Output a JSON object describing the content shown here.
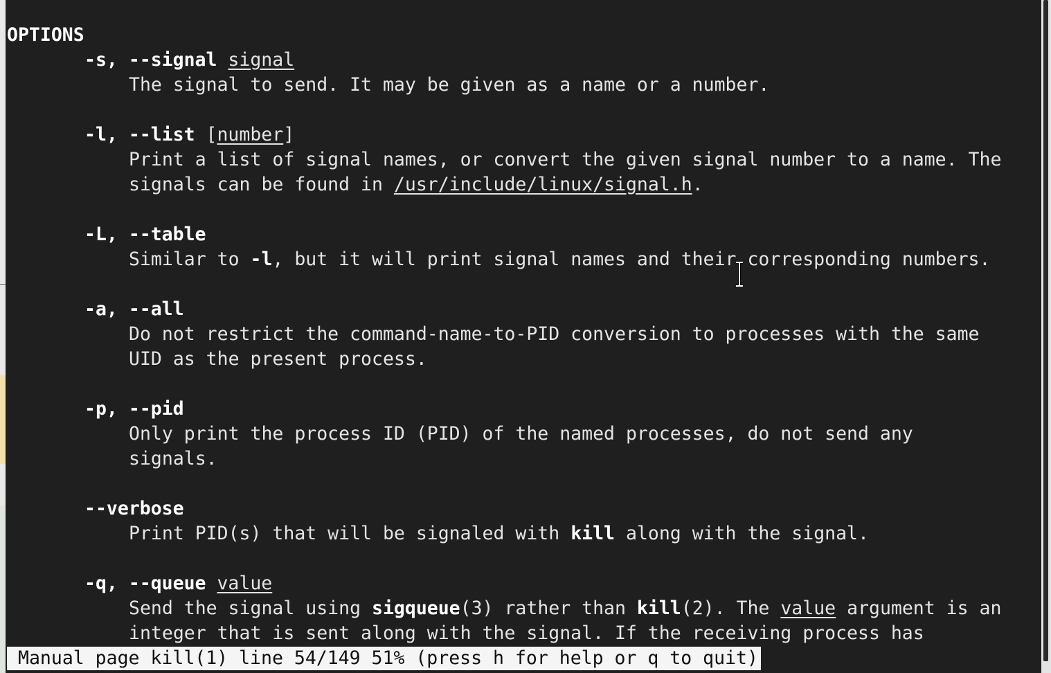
{
  "section_heading": "OPTIONS",
  "options": {
    "signal": {
      "flag": "-s, --signal",
      "arg": "signal",
      "desc": "The signal to send. It may be given as a name or a number."
    },
    "list": {
      "flag": "-l, --list",
      "arg_open": " [",
      "arg": "number",
      "arg_close": "]",
      "desc1": "Print a list of signal names, or convert the given signal number to a name. The",
      "desc2_pre": "signals can be found in ",
      "desc2_link": "/usr/include/linux/signal.h",
      "desc2_post": "."
    },
    "table": {
      "flag": "-L, --table",
      "desc_pre": "Similar to ",
      "desc_bold": "-l",
      "desc_post": ", but it will print signal names and their corresponding numbers."
    },
    "all": {
      "flag": "-a, --all",
      "desc1": "Do not restrict the command-name-to-PID conversion to processes with the same",
      "desc2": "UID as the present process."
    },
    "pid": {
      "flag": "-p, --pid",
      "desc1": "Only print the process ID (PID) of the named processes, do not send any",
      "desc2": "signals."
    },
    "verbose": {
      "flag": "--verbose",
      "desc_pre": "Print PID(s) that will be signaled with ",
      "desc_bold": "kill",
      "desc_post": " along with the signal."
    },
    "queue": {
      "flag": "-q, --queue",
      "arg": "value",
      "desc1_a": "Send the signal using ",
      "desc1_b": "sigqueue",
      "desc1_c": "(3) rather than ",
      "desc1_d": "kill",
      "desc1_e": "(2). The ",
      "desc1_f": "value",
      "desc1_g": " argument is an",
      "desc2": "integer that is sent along with the signal. If the receiving process has"
    }
  },
  "status_bar": "Manual page kill(1) line 54/149 51% (press h for help or q to quit)",
  "colors": {
    "background": "#1f1f1f",
    "text": "#e4e4e4",
    "status_bg": "#f5f5f5"
  },
  "icons": {
    "cursor": "text-cursor-icon"
  }
}
